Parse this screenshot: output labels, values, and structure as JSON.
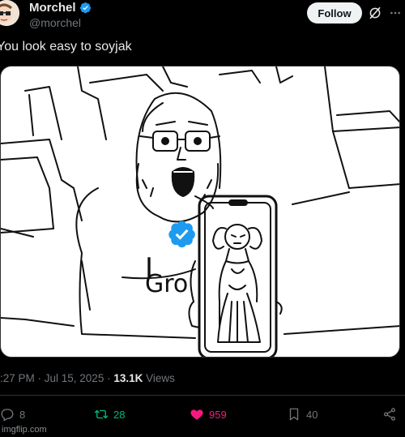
{
  "author": {
    "name": "Morchel",
    "handle": "@morchel",
    "verified": true
  },
  "header": {
    "follow_label": "Follow"
  },
  "tweet": {
    "text": "You look easy to soyjak"
  },
  "media": {
    "shirt_text_line1": "I",
    "shirt_text_line2": "Gro"
  },
  "meta": {
    "timestamp": ":27 PM · Jul 15, 2025 · ",
    "views_count": "13.1K",
    "views_label": " Views"
  },
  "actions": {
    "replies": "8",
    "reposts": "28",
    "likes": "959",
    "bookmarks": "40"
  },
  "colors": {
    "background": "#000000",
    "verified_blue": "#1d9bf0",
    "repost_green": "#00ba7c",
    "like_pink": "#f91880",
    "muted_text": "#71767b"
  },
  "watermark": "imgflip.com"
}
